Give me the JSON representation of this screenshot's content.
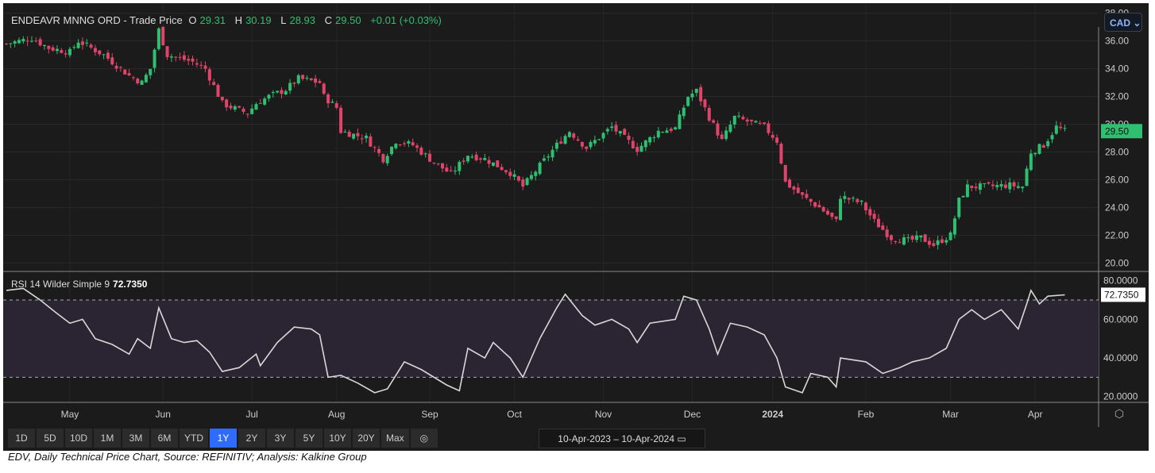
{
  "header": {
    "name": "ENDEAVR MNNG ORD - Trade Price",
    "o_label": "O",
    "o": "29.31",
    "h_label": "H",
    "h": "30.19",
    "l_label": "L",
    "l": "28.93",
    "c_label": "C",
    "c": "29.50",
    "change": "+0.01 (+0.03%)"
  },
  "currency": "CAD ⌄",
  "rsi_label": "RSI 14 Wilder Simple 9",
  "rsi_value": "72.7350",
  "buttons": [
    "1D",
    "5D",
    "10D",
    "1M",
    "3M",
    "6M",
    "YTD",
    "1Y",
    "2Y",
    "3Y",
    "5Y",
    "10Y",
    "20Y",
    "Max"
  ],
  "active_button": "1Y",
  "date_range": "10-Apr-2023  –  10-Apr-2024",
  "caption": "EDV, Daily Technical Price Chart, Source: REFINITIV; Analysis: Kalkine Group",
  "colors": {
    "up": "#2fbf71",
    "down": "#e0446a",
    "rsi": "#d8d8d8",
    "rsi_band": "#2a2433"
  },
  "chart_data": [
    {
      "type": "candlestick",
      "title": "ENDEAVR MNNG ORD - Trade Price",
      "x_unit": "trading day index",
      "last_price": "29.50",
      "ylim": [
        19.5,
        38.5
      ],
      "yticks": [
        "38.00",
        "36.00",
        "34.00",
        "32.00",
        "30.00",
        "28.00",
        "26.00",
        "24.00",
        "22.00",
        "20.00"
      ],
      "xticks": [
        {
          "day": 15,
          "label": "May"
        },
        {
          "day": 37,
          "label": "Jun"
        },
        {
          "day": 58,
          "label": "Jul"
        },
        {
          "day": 78,
          "label": "Aug"
        },
        {
          "day": 100,
          "label": "Sep"
        },
        {
          "day": 120,
          "label": "Oct"
        },
        {
          "day": 141,
          "label": "Nov"
        },
        {
          "day": 162,
          "label": "Dec"
        },
        {
          "day": 181,
          "label": "2024"
        },
        {
          "day": 203,
          "label": "Feb"
        },
        {
          "day": 223,
          "label": "Mar"
        },
        {
          "day": 243,
          "label": "Apr"
        }
      ],
      "close_path": [
        [
          0,
          35.8
        ],
        [
          6,
          36.2
        ],
        [
          10,
          35.5
        ],
        [
          15,
          35.2
        ],
        [
          17,
          36
        ],
        [
          23,
          35
        ],
        [
          29,
          33.5
        ],
        [
          32,
          33
        ],
        [
          34,
          34
        ],
        [
          36,
          36.8
        ],
        [
          38,
          35
        ],
        [
          44,
          34.5
        ],
        [
          47,
          34
        ],
        [
          51,
          31.5
        ],
        [
          55,
          31
        ],
        [
          57,
          30.8
        ],
        [
          59,
          31.5
        ],
        [
          62,
          32
        ],
        [
          66,
          32.5
        ],
        [
          69,
          33.3
        ],
        [
          74,
          33
        ],
        [
          75,
          32
        ],
        [
          78,
          31.2
        ],
        [
          79,
          29.5
        ],
        [
          85,
          29
        ],
        [
          89,
          27.5
        ],
        [
          92,
          28.8
        ],
        [
          96,
          28.5
        ],
        [
          100,
          27.5
        ],
        [
          105,
          26.4
        ],
        [
          109,
          27.8
        ],
        [
          113,
          27.5
        ],
        [
          119,
          26.5
        ],
        [
          122,
          25.5
        ],
        [
          126,
          27
        ],
        [
          130,
          28.5
        ],
        [
          133,
          29.5
        ],
        [
          137,
          28.3
        ],
        [
          143,
          29.8
        ],
        [
          149,
          28.2
        ],
        [
          154,
          29.5
        ],
        [
          158,
          29.7
        ],
        [
          161,
          32
        ],
        [
          163,
          32.4
        ],
        [
          166,
          30.5
        ],
        [
          169,
          28.8
        ],
        [
          172,
          30.5
        ],
        [
          179,
          29.8
        ],
        [
          182,
          28.8
        ],
        [
          184,
          25.8
        ],
        [
          188,
          24.8
        ],
        [
          192,
          24
        ],
        [
          196,
          23
        ],
        [
          197,
          24.8
        ],
        [
          202,
          24.3
        ],
        [
          205,
          23
        ],
        [
          209,
          21.8
        ],
        [
          213,
          21.6
        ],
        [
          216,
          21.8
        ],
        [
          219,
          21.3
        ],
        [
          223,
          22
        ],
        [
          225,
          24.5
        ],
        [
          227,
          25.5
        ],
        [
          231,
          25.5
        ],
        [
          237,
          25.6
        ],
        [
          240,
          25.5
        ],
        [
          242,
          28
        ],
        [
          245,
          28.5
        ],
        [
          248,
          29.8
        ],
        [
          250,
          29.5
        ]
      ]
    },
    {
      "type": "line",
      "title": "RSI 14 Wilder Simple 9",
      "ylim": [
        17,
        84
      ],
      "bands": [
        30,
        70
      ],
      "yticks": [
        "80.0000",
        "60.0000",
        "40.0000",
        "20.0000"
      ],
      "last_value": "72.7350",
      "points": [
        [
          0,
          75
        ],
        [
          4,
          76
        ],
        [
          8,
          70
        ],
        [
          12,
          63
        ],
        [
          15,
          58
        ],
        [
          18,
          60
        ],
        [
          21,
          50
        ],
        [
          25,
          47
        ],
        [
          29,
          42
        ],
        [
          31,
          50
        ],
        [
          34,
          45
        ],
        [
          36,
          66
        ],
        [
          39,
          50
        ],
        [
          42,
          48
        ],
        [
          45,
          49
        ],
        [
          48,
          43
        ],
        [
          51,
          33
        ],
        [
          55,
          35
        ],
        [
          59,
          42
        ],
        [
          60,
          36
        ],
        [
          64,
          48
        ],
        [
          68,
          56
        ],
        [
          72,
          55
        ],
        [
          74,
          52
        ],
        [
          76,
          30
        ],
        [
          79,
          31
        ],
        [
          83,
          27
        ],
        [
          87,
          22
        ],
        [
          90,
          24
        ],
        [
          94,
          38
        ],
        [
          98,
          34
        ],
        [
          104,
          26
        ],
        [
          107,
          23
        ],
        [
          109,
          45
        ],
        [
          113,
          40
        ],
        [
          115,
          48
        ],
        [
          119,
          40
        ],
        [
          122,
          30
        ],
        [
          126,
          50
        ],
        [
          130,
          66
        ],
        [
          132,
          73
        ],
        [
          136,
          62
        ],
        [
          139,
          57
        ],
        [
          143,
          60
        ],
        [
          147,
          55
        ],
        [
          149,
          48
        ],
        [
          152,
          58
        ],
        [
          158,
          60
        ],
        [
          160,
          72
        ],
        [
          163,
          70
        ],
        [
          166,
          55
        ],
        [
          168,
          42
        ],
        [
          171,
          58
        ],
        [
          175,
          56
        ],
        [
          179,
          52
        ],
        [
          182,
          40
        ],
        [
          184,
          25
        ],
        [
          188,
          22
        ],
        [
          190,
          32
        ],
        [
          194,
          30
        ],
        [
          196,
          25
        ],
        [
          197,
          40
        ],
        [
          203,
          38
        ],
        [
          207,
          32
        ],
        [
          211,
          35
        ],
        [
          214,
          38
        ],
        [
          218,
          40
        ],
        [
          222,
          45
        ],
        [
          225,
          60
        ],
        [
          228,
          65
        ],
        [
          231,
          60
        ],
        [
          235,
          65
        ],
        [
          239,
          55
        ],
        [
          241,
          68
        ],
        [
          242,
          75
        ],
        [
          244,
          68
        ],
        [
          246,
          72
        ],
        [
          250,
          72.7
        ]
      ]
    }
  ]
}
